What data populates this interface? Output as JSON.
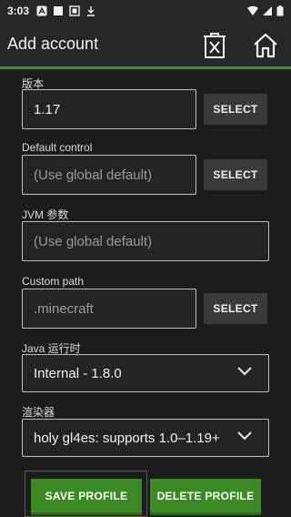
{
  "status": {
    "time": "3:03"
  },
  "appbar": {
    "title": "Add account",
    "delete_icon": "delete-profile-icon",
    "home_icon": "home-icon"
  },
  "form": {
    "version": {
      "label": "版本",
      "value": "1.17",
      "select": "SELECT"
    },
    "control": {
      "label": "Default control",
      "placeholder": "(Use global default)",
      "select": "SELECT"
    },
    "jvm": {
      "label": "JVM 参数",
      "placeholder": "(Use global default)"
    },
    "path": {
      "label": "Custom path",
      "placeholder": ".minecraft",
      "select": "SELECT"
    },
    "java": {
      "label": "Java 运行时",
      "value": "Internal - 1.8.0"
    },
    "renderer": {
      "label": "渲染器",
      "value": "holy gl4es: supports 1.0–1.19+"
    }
  },
  "actions": {
    "save": "SAVE PROFILE",
    "delete": "DELETE PROFILE"
  },
  "colors": {
    "accent": "#3f8f2e",
    "button_green": "#3b8b24",
    "background": "#1c1c1c"
  }
}
